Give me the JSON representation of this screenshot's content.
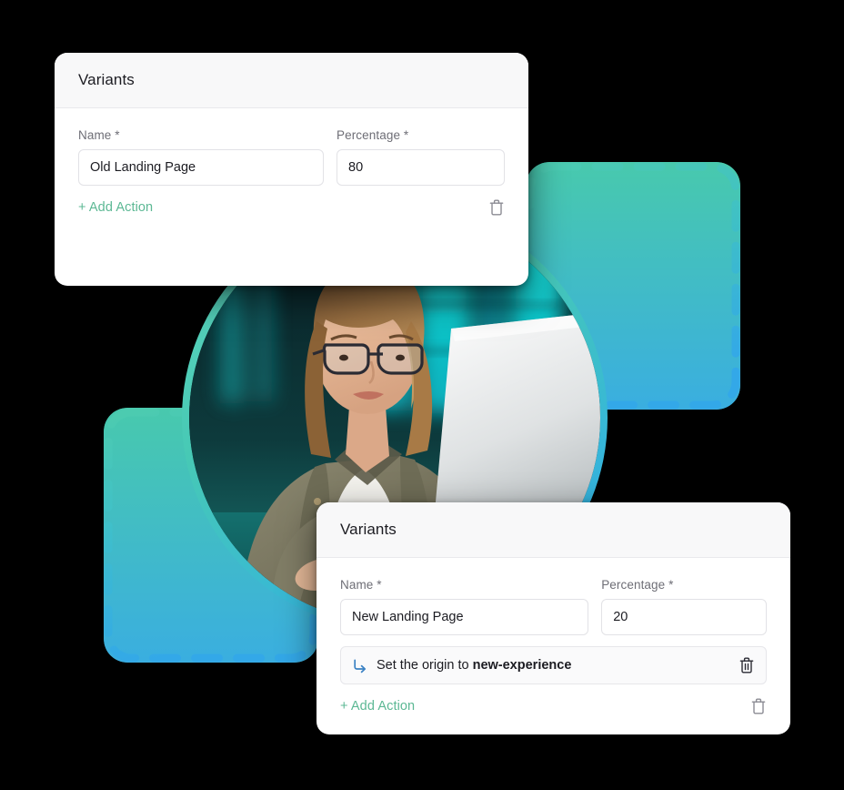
{
  "theme": {
    "background": "#000000",
    "accent_green": "#5cb894",
    "accent_teal": "#47c9b5",
    "accent_blue": "#2fa9e6",
    "card_background": "#ffffff",
    "card_header_background": "#f8f8f9",
    "label_color": "#6e6e76",
    "text_color": "#1c1c22",
    "input_border": "#e2e2e6"
  },
  "cards": [
    {
      "id": "variant-old",
      "title": "Variants",
      "name": {
        "label": "Name *",
        "value": "Old Landing Page",
        "placeholder": "Name"
      },
      "percentage": {
        "label": "Percentage *",
        "value": "80",
        "placeholder": "Percentage"
      },
      "actions": [],
      "add_action_label": "+ Add Action",
      "delete_icon": "trash-icon"
    },
    {
      "id": "variant-new",
      "title": "Variants",
      "name": {
        "label": "Name *",
        "value": "New Landing Page",
        "placeholder": "Name"
      },
      "percentage": {
        "label": "Percentage *",
        "value": "20",
        "placeholder": "Percentage"
      },
      "actions": [
        {
          "icon": "corner-down-right-arrow-icon",
          "text_prefix": "Set the origin to ",
          "text_emphasis": "new-experience",
          "delete_icon": "trash-icon"
        }
      ],
      "add_action_label": "+ Add Action",
      "delete_icon": "trash-icon"
    }
  ],
  "decorations": {
    "dashed_frame_right": {
      "name": "dashed-frame-right"
    },
    "dashed_frame_left": {
      "name": "dashed-frame-left"
    },
    "photo": {
      "name": "photo-circle",
      "alt": "Woman with glasses working on a laptop in a teal-lit office"
    }
  }
}
